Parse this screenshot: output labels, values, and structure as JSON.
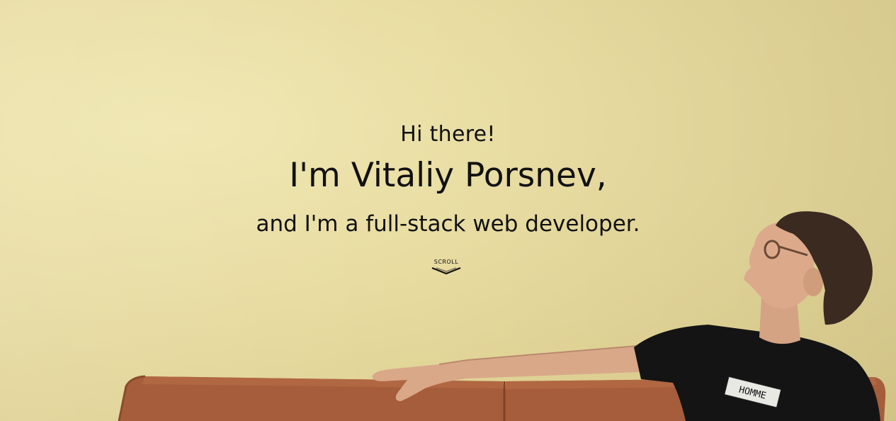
{
  "hero": {
    "greeting": "Hi there!",
    "name": "I'm Vitaliy Porsnev,",
    "tagline": "and I'm a full-stack web developer.",
    "scroll_label": "SCROLL"
  },
  "photo": {
    "shirt_print": "HOMME"
  },
  "colors": {
    "wall": "#e8dca1",
    "sofa": "#a85f3e",
    "shirt": "#141414",
    "text": "#111111"
  },
  "icons": [
    "chevron-down-icon"
  ]
}
